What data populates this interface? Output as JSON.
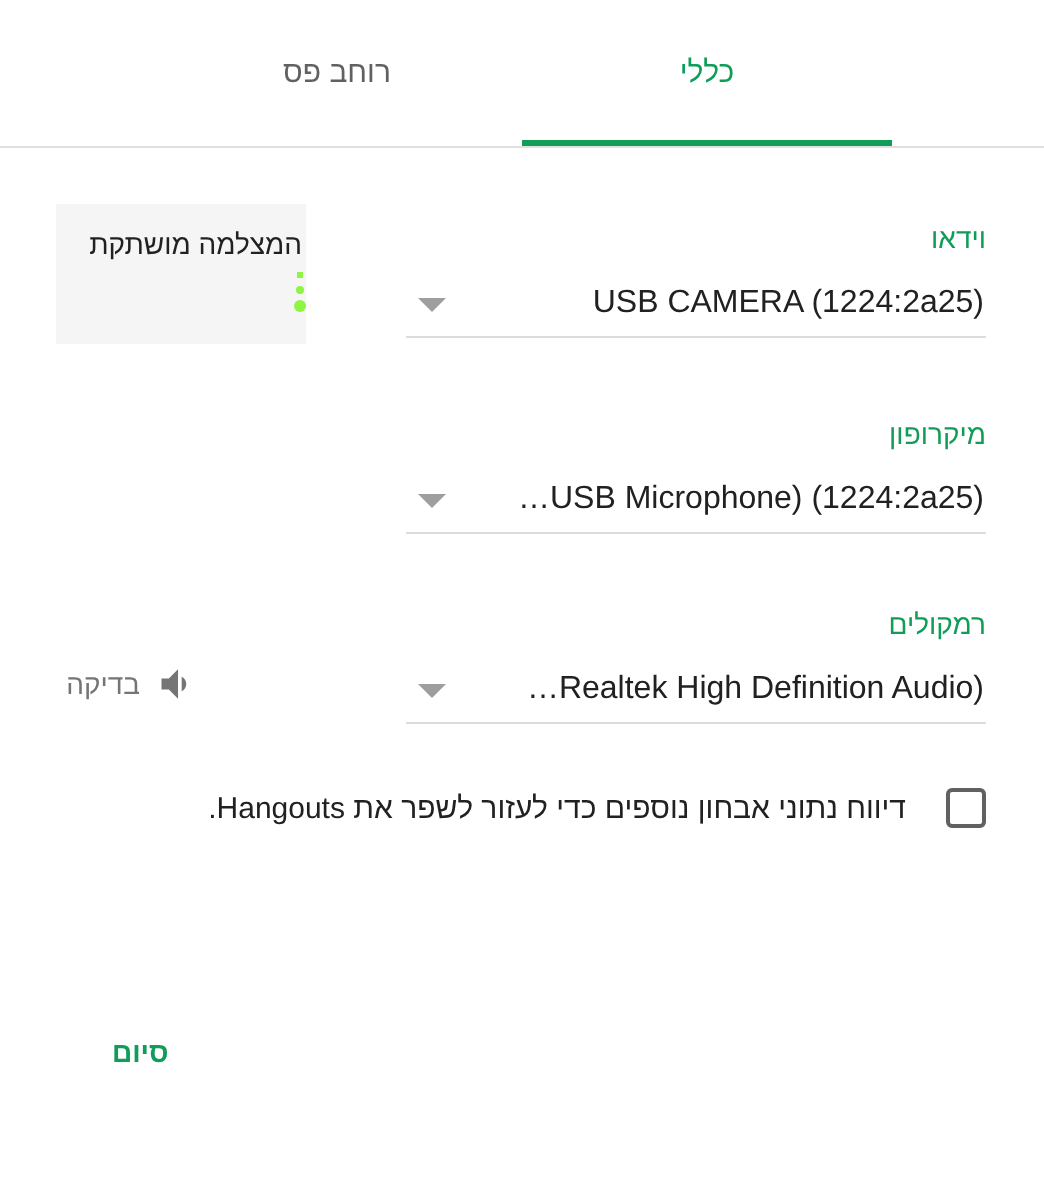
{
  "tabs": [
    {
      "label": "כללי",
      "selected": true
    },
    {
      "label": "רוחב פס",
      "selected": false
    }
  ],
  "preview": {
    "caption": "המצלמה מושתקת"
  },
  "devices": [
    {
      "label": "וידאו",
      "value": "USB CAMERA (1224:2a25)",
      "kind": "plain"
    },
    {
      "label": "מיקרופון",
      "value": "…USB Microphone) (1224:2a25)",
      "kind": "plain"
    },
    {
      "label": "רמקולים",
      "value": "…Realtek High Definition Audio)",
      "kind": "test",
      "test_label": "בדיקה"
    }
  ],
  "diagnostics": {
    "label": "דיווח נתוני אבחון נוספים כדי לעזור לשפר את Hangouts.",
    "checked": false
  },
  "done_button": "סיום"
}
